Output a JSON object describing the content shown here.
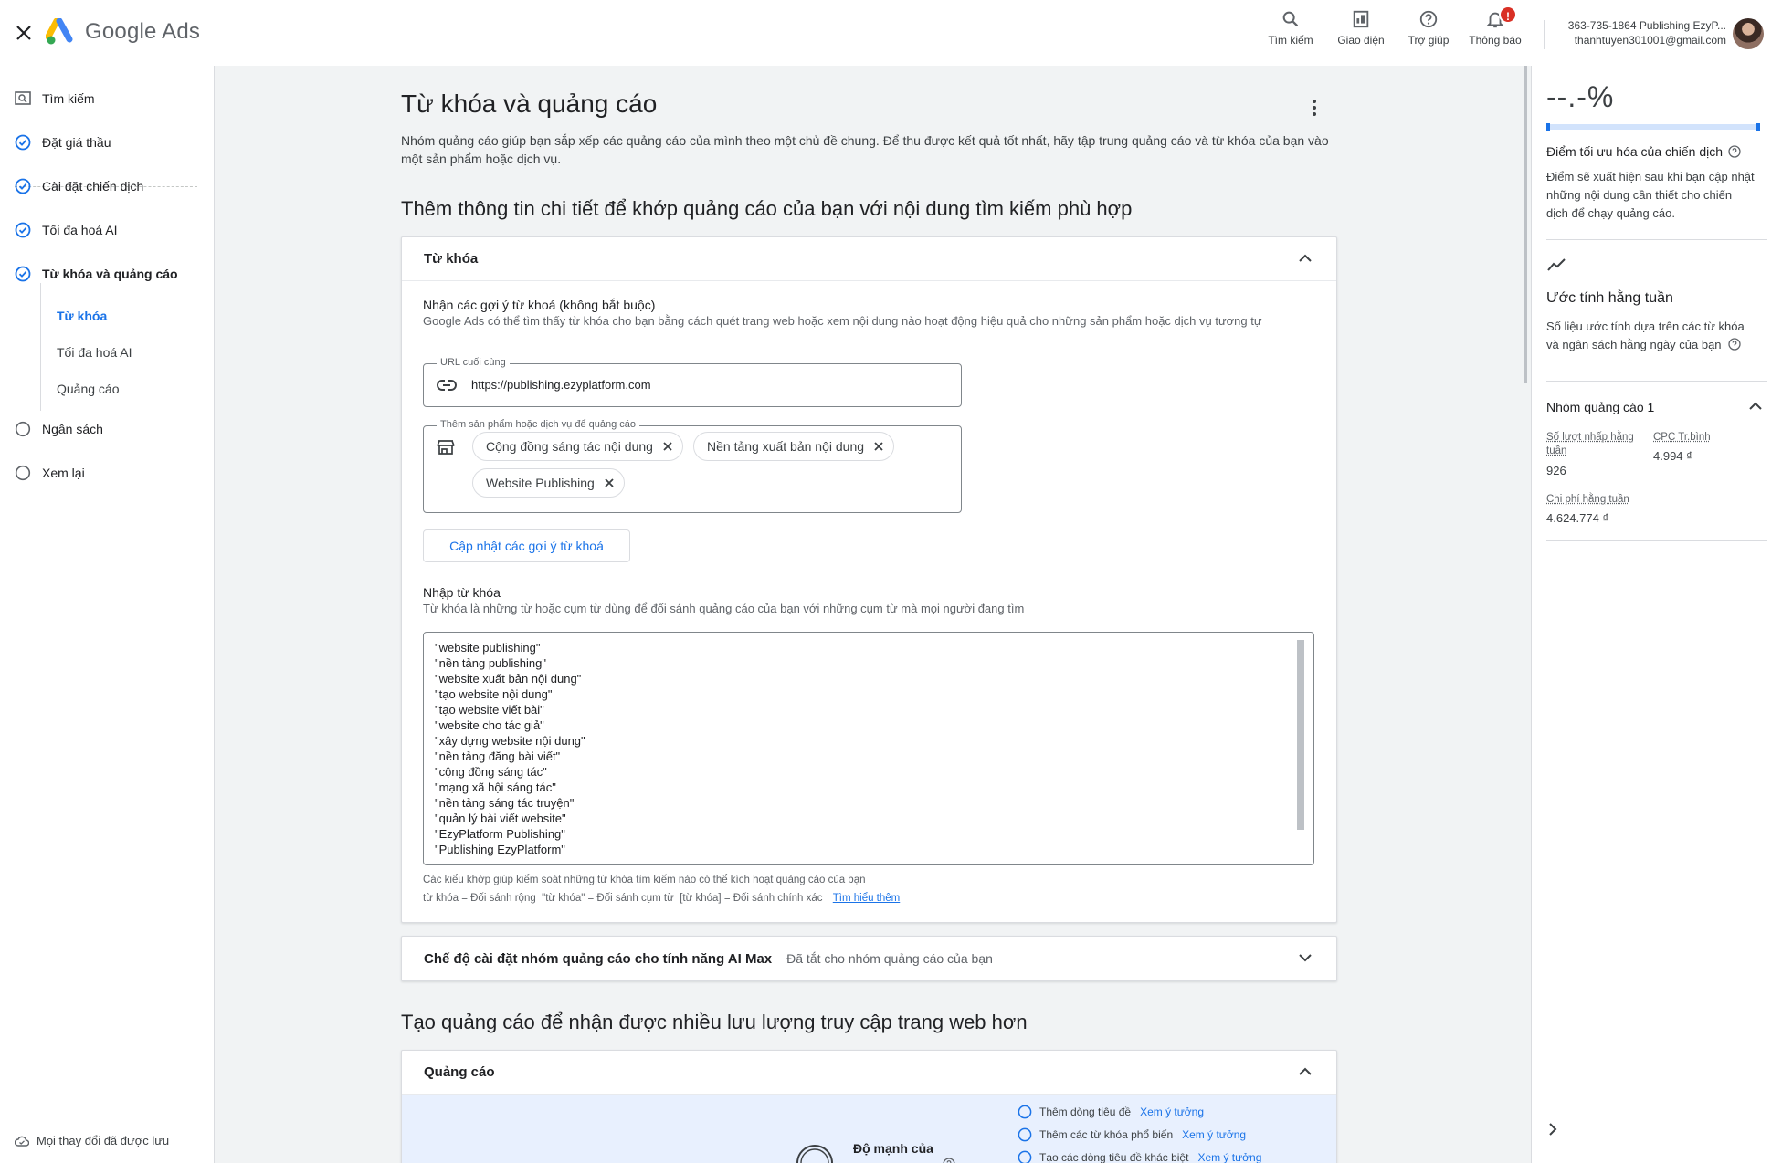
{
  "header": {
    "brand": "Google Ads",
    "actions": [
      {
        "label": "Tìm kiếm",
        "icon": "search-icon"
      },
      {
        "label": "Giao diện",
        "icon": "appearance-icon"
      },
      {
        "label": "Trợ giúp",
        "icon": "help-icon"
      },
      {
        "label": "Thông báo",
        "icon": "bell-icon",
        "badge": "!"
      }
    ],
    "account_line1": "363-735-1864 Publishing EzyP...",
    "account_line2": "thanhtuyen301001@gmail.com"
  },
  "nav": {
    "items": [
      {
        "label": "Tìm kiếm"
      },
      {
        "label": "Đặt giá thầu"
      },
      {
        "label": "Cài đặt chiến dịch"
      },
      {
        "label": "Tối đa hoá AI"
      },
      {
        "label": "Từ khóa và quảng cáo"
      },
      {
        "label": "Ngân sách"
      },
      {
        "label": "Xem lại"
      }
    ],
    "subitems": [
      {
        "label": "Từ khóa"
      },
      {
        "label": "Tối đa hoá AI"
      },
      {
        "label": "Quảng cáo"
      }
    ],
    "saved_text": "Mọi thay đổi đã được lưu"
  },
  "main": {
    "title": "Từ khóa và quảng cáo",
    "description": "Nhóm quảng cáo giúp bạn sắp xếp các quảng cáo của mình theo một chủ đề chung. Để thu được kết quả tốt nhất, hãy tập trung quảng cáo và từ khóa của bạn vào một sản phẩm hoặc dịch vụ.",
    "section1_title": "Thêm thông tin chi tiết để khớp quảng cáo của bạn với nội dung tìm kiếm phù hợp",
    "keywords_card": {
      "title": "Từ khóa",
      "suggest_label": "Nhận các gợi ý từ khoá (không bắt buộc)",
      "suggest_desc": "Google Ads có thể tìm thấy từ khóa cho bạn bằng cách quét trang web hoặc xem nội dung nào hoạt động hiệu quả cho những sản phẩm hoặc dịch vụ tương tự",
      "url_legend": "URL cuối cùng",
      "url_value": "https://publishing.ezyplatform.com",
      "products_legend": "Thêm sản phẩm hoặc dịch vụ để quảng cáo",
      "chips": [
        "Cộng đồng sáng tác nội dung",
        "Nền tảng xuất bản nội dung",
        "Website Publishing"
      ],
      "update_button": "Cập nhật các gợi ý từ khoá",
      "enter_label": "Nhập từ khóa",
      "enter_desc": "Từ khóa là những từ hoặc cụm từ dùng để đối sánh quảng cáo của bạn với những cụm từ mà mọi người đang tìm",
      "keywords": [
        "\"website publishing\"",
        "\"nền tảng publishing\"",
        "\"website xuất bản nội dung\"",
        "\"tạo website nội dung\"",
        "\"tạo website viết bài\"",
        "\"website cho tác giả\"",
        "\"xây dựng website nội dung\"",
        "\"nền tảng đăng bài viết\"",
        "\"cộng đồng sáng tác\"",
        "\"mạng xã hội sáng tác\"",
        "\"nền tảng sáng tác truyện\"",
        "\"quản lý bài viết website\"",
        "\"EzyPlatform Publishing\"",
        "\"Publishing EzyPlatform\""
      ],
      "hint1": "Các kiểu khớp giúp kiểm soát những từ khóa tìm kiếm nào có thể kích hoạt quảng cáo của bạn",
      "hint2": "từ khóa = Đối sánh rộng  \"từ khóa\" = Đối sánh cụm từ  [từ khóa] = Đối sánh chính xác",
      "learn_more": "Tìm hiểu thêm"
    },
    "aimax_card": {
      "title": "Chế độ cài đặt nhóm quảng cáo cho tính năng AI Max",
      "status": "Đã tắt cho nhóm quảng cáo của bạn"
    },
    "section2_title": "Tạo quảng cáo để nhận được nhiều lưu lượng truy cập trang web hơn",
    "ads_card": {
      "title": "Quảng cáo",
      "strength_label": "Độ mạnh của",
      "tips": [
        {
          "text": "Thêm dòng tiêu đề",
          "link": "Xem ý tưởng"
        },
        {
          "text": "Thêm các từ khóa phổ biến",
          "link": "Xem ý tưởng"
        },
        {
          "text": "Tạo các dòng tiêu đề khác biệt",
          "link": "Xem ý tưởng"
        }
      ]
    }
  },
  "right_panel": {
    "score": "--.-%",
    "opt_title": "Điểm tối ưu hóa của chiến dịch",
    "opt_desc": "Điểm sẽ xuất hiện sau khi bạn cập nhật những nội dung cần thiết cho chiến dịch để chạy quảng cáo.",
    "weekly_title": "Ước tính hằng tuần",
    "weekly_desc": "Số liệu ước tính dựa trên các từ khóa và ngân sách hằng ngày của bạn",
    "group_title": "Nhóm quảng cáo 1",
    "clicks_label": "Số lượt nhấp hằng tuần",
    "clicks_value": "926",
    "cpc_label": "CPC Tr.bình",
    "cpc_value": "4.994 ₫",
    "cost_label": "Chi phí hằng tuần",
    "cost_value": "4.624.774 ₫"
  },
  "colors": {
    "accent": "#1a73e8",
    "badge": "#d93025",
    "ads_bg": "#e8f0fe"
  }
}
